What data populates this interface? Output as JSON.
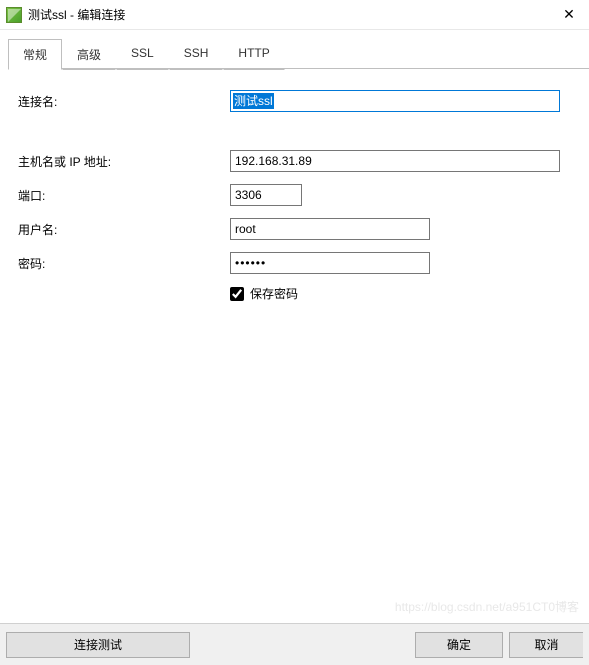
{
  "window": {
    "title": "测试ssl - 编辑连接"
  },
  "tabs": [
    {
      "label": "常规",
      "active": true
    },
    {
      "label": "高级",
      "active": false
    },
    {
      "label": "SSL",
      "active": false
    },
    {
      "label": "SSH",
      "active": false
    },
    {
      "label": "HTTP",
      "active": false
    }
  ],
  "form": {
    "connection_name": {
      "label": "连接名:",
      "value": "测试ssl"
    },
    "host": {
      "label": "主机名或 IP 地址:",
      "value": "192.168.31.89"
    },
    "port": {
      "label": "端口:",
      "value": "3306"
    },
    "user": {
      "label": "用户名:",
      "value": "root"
    },
    "password": {
      "label": "密码:",
      "value": "••••••"
    },
    "save_password": {
      "label": "保存密码",
      "checked": true
    }
  },
  "footer": {
    "test": "连接测试",
    "ok": "确定",
    "cancel": "取消"
  }
}
